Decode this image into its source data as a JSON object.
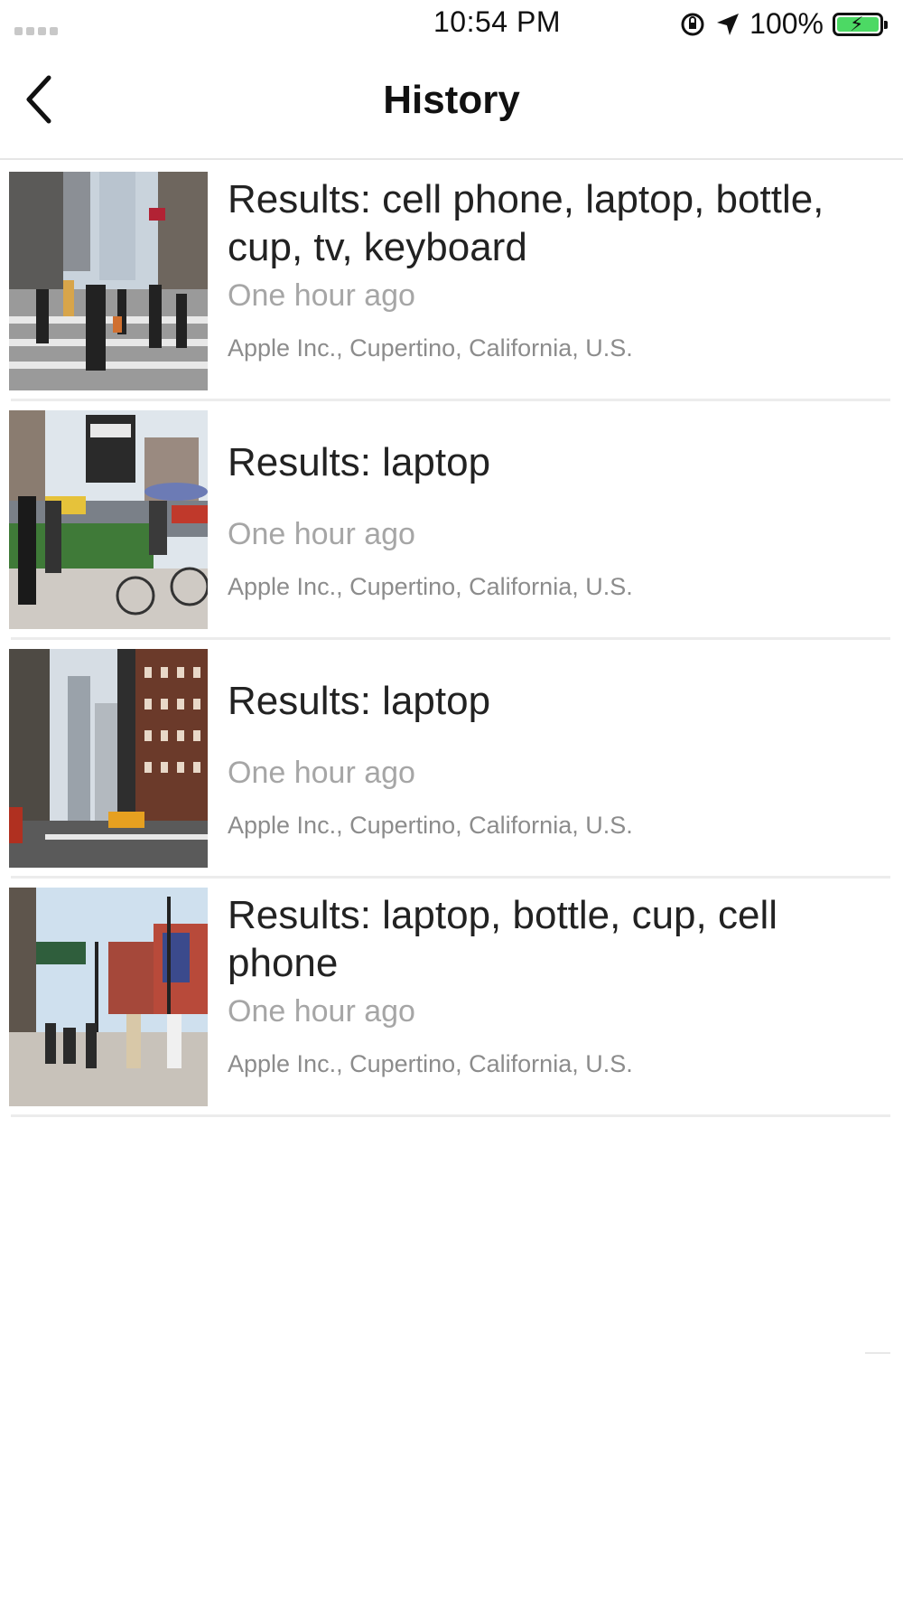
{
  "status_bar": {
    "time": "10:54 PM",
    "battery_percent": "100%",
    "battery_charging": true,
    "icons": [
      "signal-dots-icon",
      "orientation-lock-icon",
      "location-arrow-icon",
      "battery-charging-icon"
    ]
  },
  "nav": {
    "title": "History",
    "back_icon": "chevron-left-icon"
  },
  "history": [
    {
      "title": "Results: cell phone, laptop, bottle, cup, tv, keyboard",
      "time": "One hour ago",
      "location": "Apple Inc., Cupertino, California, U.S."
    },
    {
      "title": "Results: laptop",
      "time": "One hour ago",
      "location": "Apple Inc., Cupertino, California, U.S."
    },
    {
      "title": "Results: laptop",
      "time": "One hour ago",
      "location": "Apple Inc., Cupertino, California, U.S."
    },
    {
      "title": "Results: laptop, bottle, cup, cell phone",
      "time": "One hour ago",
      "location": "Apple Inc., Cupertino, California, U.S."
    }
  ],
  "colors": {
    "battery_fill": "#4cd964",
    "separator": "#ececec",
    "time_text": "#a6a6a6",
    "location_text": "#8c8c8c"
  }
}
